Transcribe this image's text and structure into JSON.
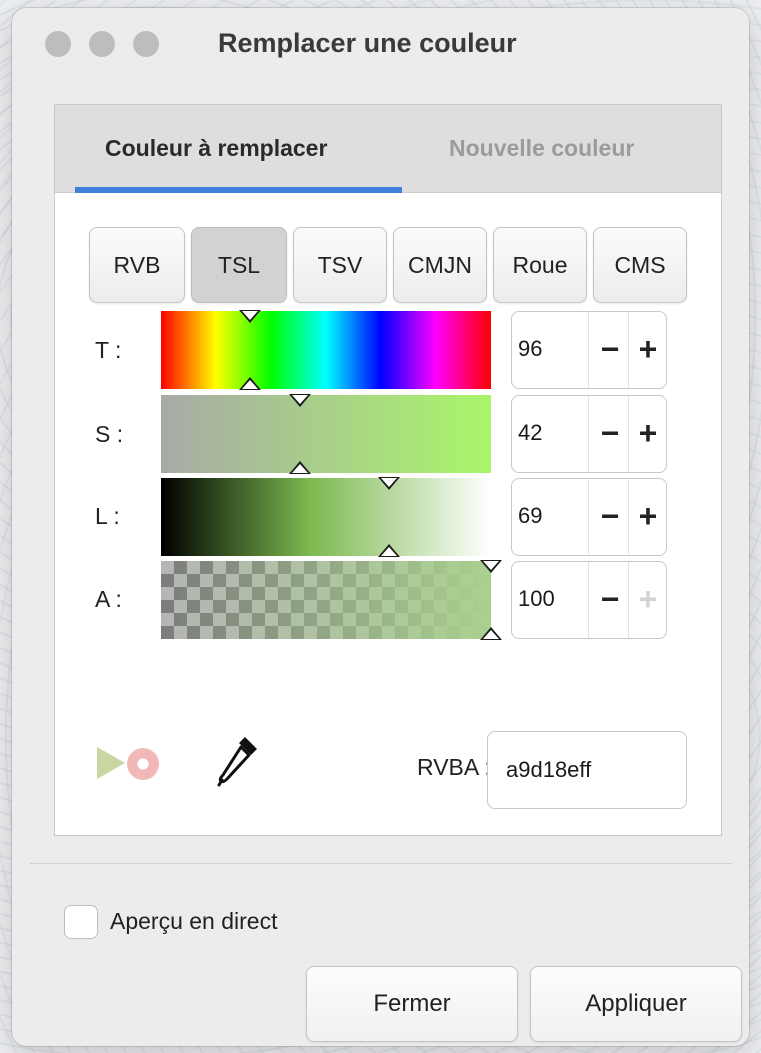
{
  "window": {
    "title": "Remplacer une couleur"
  },
  "tabs": [
    {
      "label": "Couleur à remplacer",
      "active": true
    },
    {
      "label": "Nouvelle couleur",
      "active": false
    }
  ],
  "modes": [
    {
      "label": "RVB",
      "selected": false
    },
    {
      "label": "TSL",
      "selected": true
    },
    {
      "label": "TSV",
      "selected": false
    },
    {
      "label": "CMJN",
      "selected": false
    },
    {
      "label": "Roue",
      "selected": false
    },
    {
      "label": "CMS",
      "selected": false
    }
  ],
  "channels": [
    {
      "label": "T :",
      "value": "96",
      "level": 0.27
    },
    {
      "label": "S :",
      "value": "42",
      "level": 0.42
    },
    {
      "label": "L :",
      "value": "69",
      "level": 0.69
    },
    {
      "label": "A :",
      "value": "100",
      "level": 1.0
    }
  ],
  "spin": {
    "minus": "−",
    "plus": "+"
  },
  "rvba": {
    "label": "RVBA :",
    "value": "a9d18eff"
  },
  "live_preview": {
    "label": "Aperçu en direct",
    "checked": false
  },
  "buttons": {
    "close": "Fermer",
    "apply": "Appliquer"
  },
  "colors": {
    "accent": "#3d7fd9",
    "current_color": "#a9d18e"
  }
}
